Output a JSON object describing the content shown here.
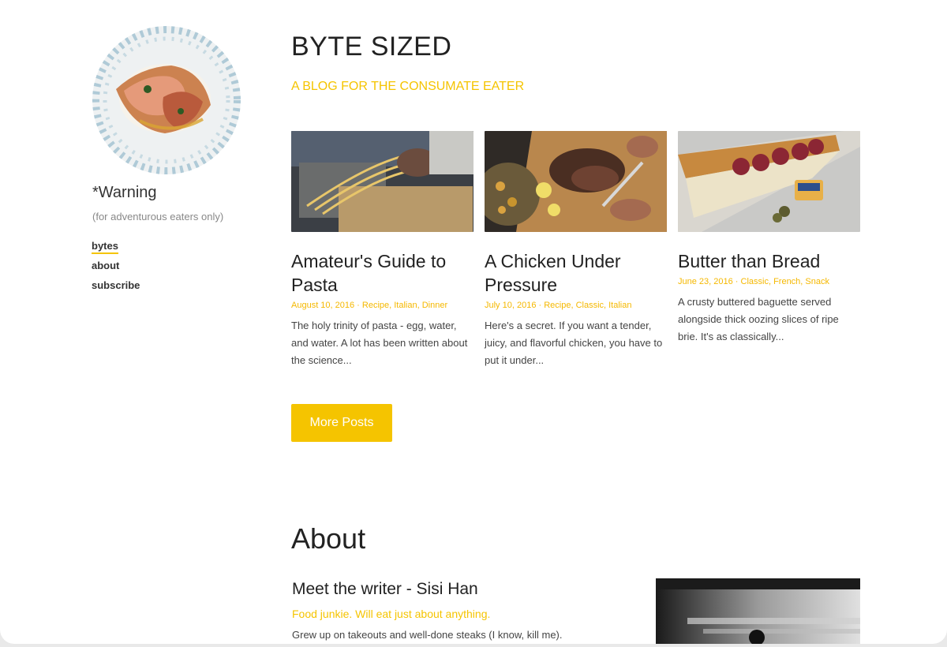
{
  "sidebar": {
    "warning": "*Warning",
    "tagline": "(for adventurous eaters only)",
    "nav": [
      {
        "label": "bytes"
      },
      {
        "label": "about"
      },
      {
        "label": "subscribe"
      }
    ]
  },
  "header": {
    "title": "BYTE SIZED",
    "subtitle": "A BLOG FOR THE CONSUMATE EATER"
  },
  "posts": [
    {
      "title": "Amateur's Guide to Pasta",
      "meta": "August 10, 2016 · Recipe, Italian, Dinner",
      "excerpt": "The holy trinity of pasta - egg, water, and water. A lot has been written about the science..."
    },
    {
      "title": "A Chicken Under Pressure",
      "meta": "July 10, 2016 · Recipe, Classic, Italian",
      "excerpt": "Here's a secret. If you want a tender, juicy, and flavorful chicken, you have to put it under..."
    },
    {
      "title": "Butter than Bread",
      "meta": "June 23, 2016 · Classic, French, Snack",
      "excerpt": "A crusty buttered baguette served alongside thick oozing slices of ripe brie. It's as classically..."
    }
  ],
  "more_button": "More Posts",
  "about": {
    "heading": "About",
    "meet": "Meet the writer - Sisi Han",
    "junkie": "Food junkie. Will eat just about anything.",
    "grew": "Grew up on takeouts and well-done steaks (I know, kill me)."
  },
  "colors": {
    "accent": "#f5c400",
    "text": "#222222",
    "muted": "#888888"
  }
}
